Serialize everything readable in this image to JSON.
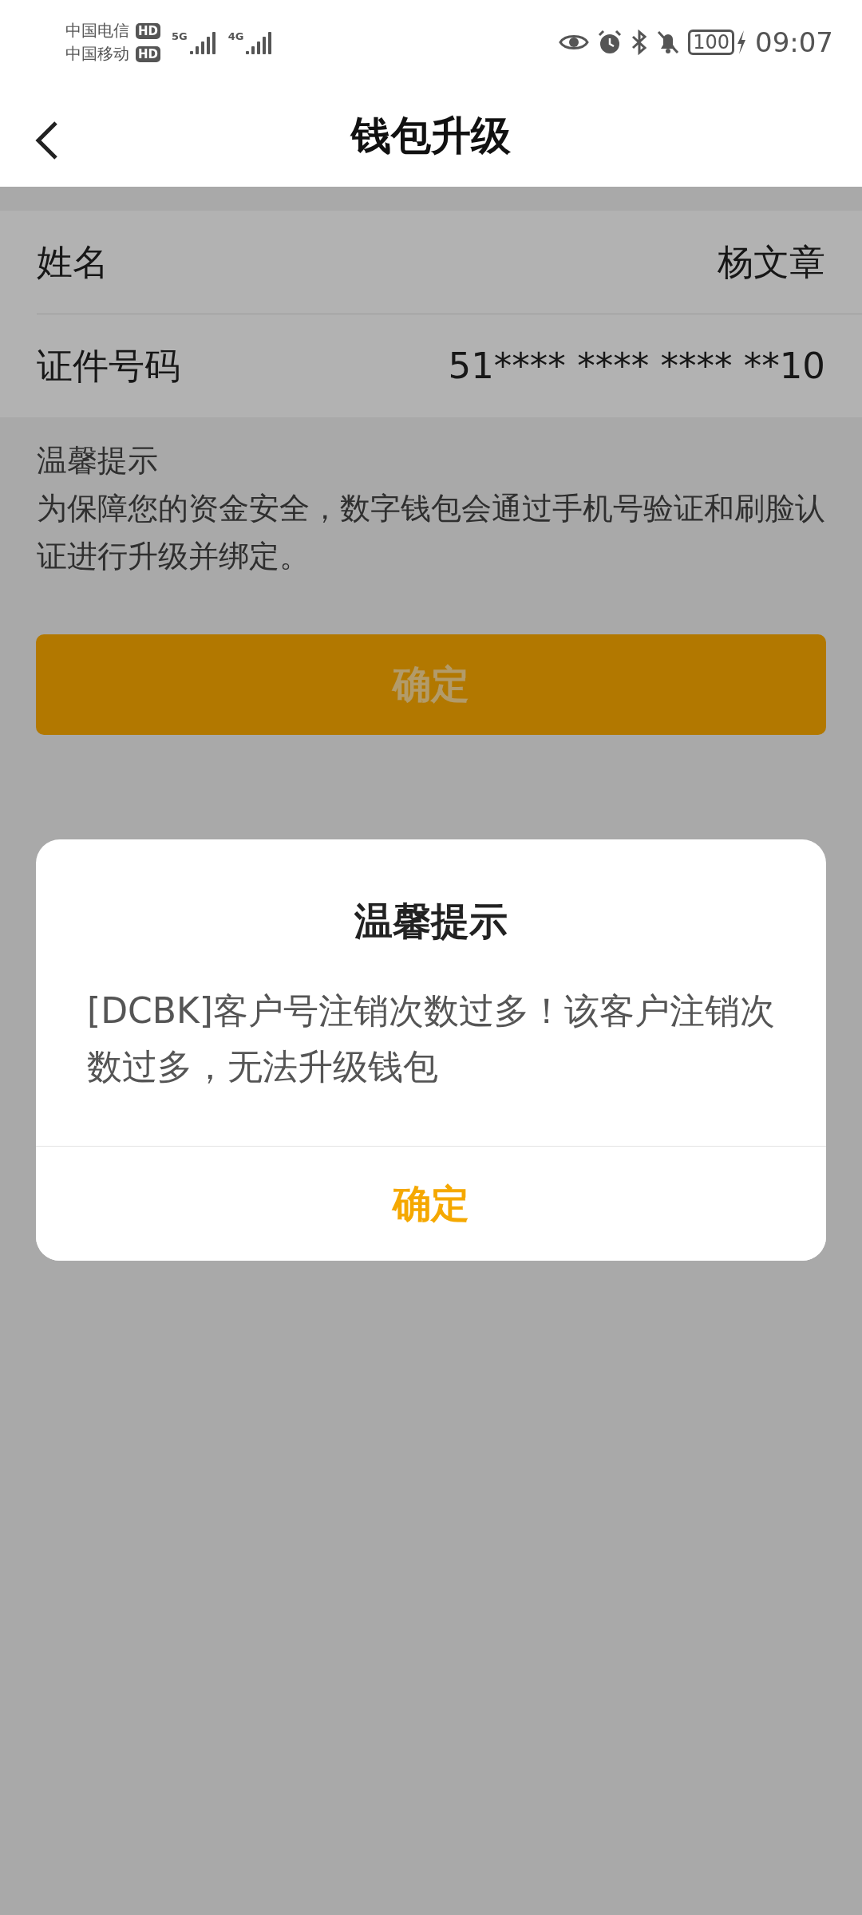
{
  "status_bar": {
    "carriers": [
      {
        "name": "中国电信",
        "badge": "HD"
      },
      {
        "name": "中国移动",
        "badge": "HD"
      }
    ],
    "networks": [
      "5G",
      "4G"
    ],
    "battery": "100",
    "time": "09:07"
  },
  "header": {
    "title": "钱包升级"
  },
  "info_rows": [
    {
      "label": "姓名",
      "value": "杨文章"
    },
    {
      "label": "证件号码",
      "value": "51**** **** **** **10"
    }
  ],
  "tips": {
    "title": "温馨提示",
    "text": "为保障您的资金安全，数字钱包会通过手机号验证和刷脸认证进行升级并绑定。"
  },
  "confirm_button": {
    "label": "确定"
  },
  "dialog": {
    "title": "温馨提示",
    "message": "[DCBK]客户号注销次数过多！该客户注销次数过多，无法升级钱包",
    "button": "确定"
  }
}
